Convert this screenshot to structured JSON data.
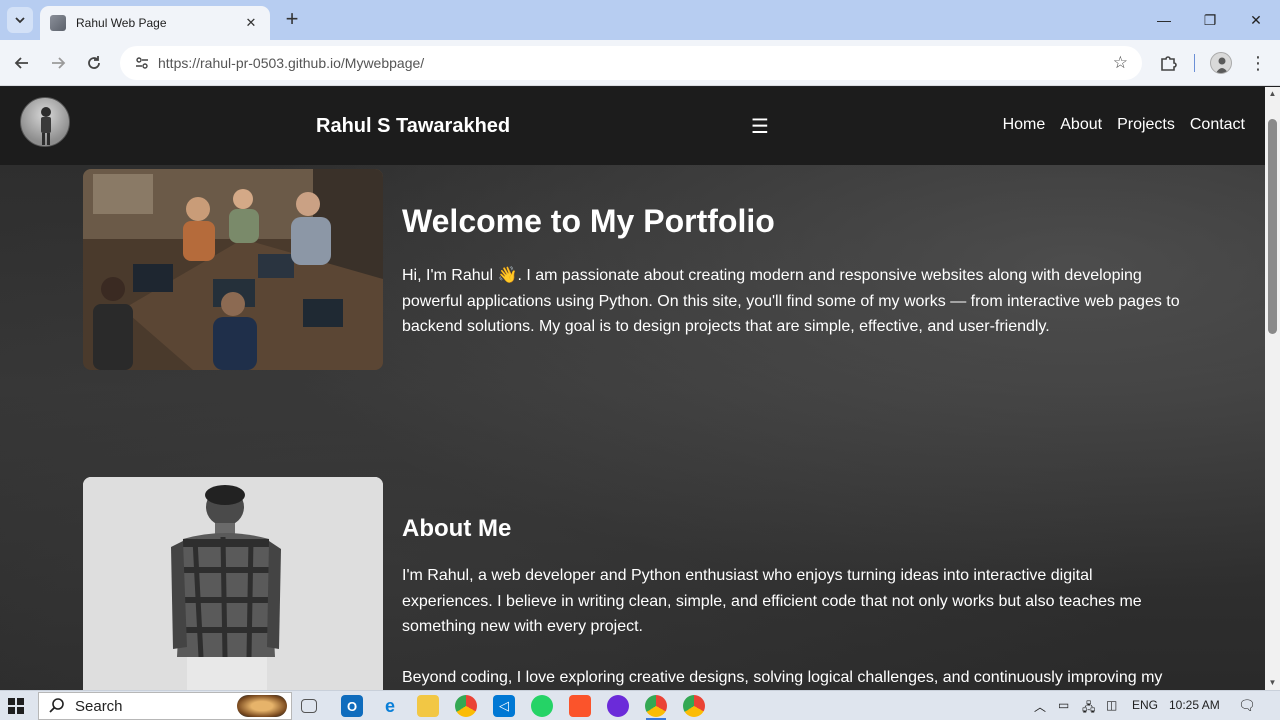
{
  "browser": {
    "tab_title": "Rahul Web Page",
    "tab_close": "✕",
    "new_tab": "+",
    "url_host": "https://rahul-pr-0503.github.io",
    "url_path": "/Mywebpage/",
    "window_controls": [
      "—",
      "❐",
      "✕"
    ]
  },
  "site": {
    "name": "Rahul S Tawarakhed",
    "menu_icon": "☰",
    "nav": [
      "Home",
      "About",
      "Projects",
      "Contact"
    ]
  },
  "hero": {
    "title": "Welcome to My Portfolio",
    "text": "Hi, I'm Rahul 👋. I am passionate about creating modern and responsive websites along with developing powerful applications using Python. On this site, you'll find some of my works — from interactive web pages to backend solutions. My goal is to design projects that are simple, effective, and user-friendly."
  },
  "about": {
    "title": "About Me",
    "text1": "I'm Rahul, a web developer and Python enthusiast who enjoys turning ideas into interactive digital experiences. I believe in writing clean, simple, and efficient code that not only works but also teaches me something new with every project.",
    "text2": "Beyond coding, I love exploring creative designs, solving logical challenges, and continuously improving my"
  },
  "taskbar": {
    "search_label": "Search",
    "lang": "ENG",
    "time": "10:25 AM"
  }
}
